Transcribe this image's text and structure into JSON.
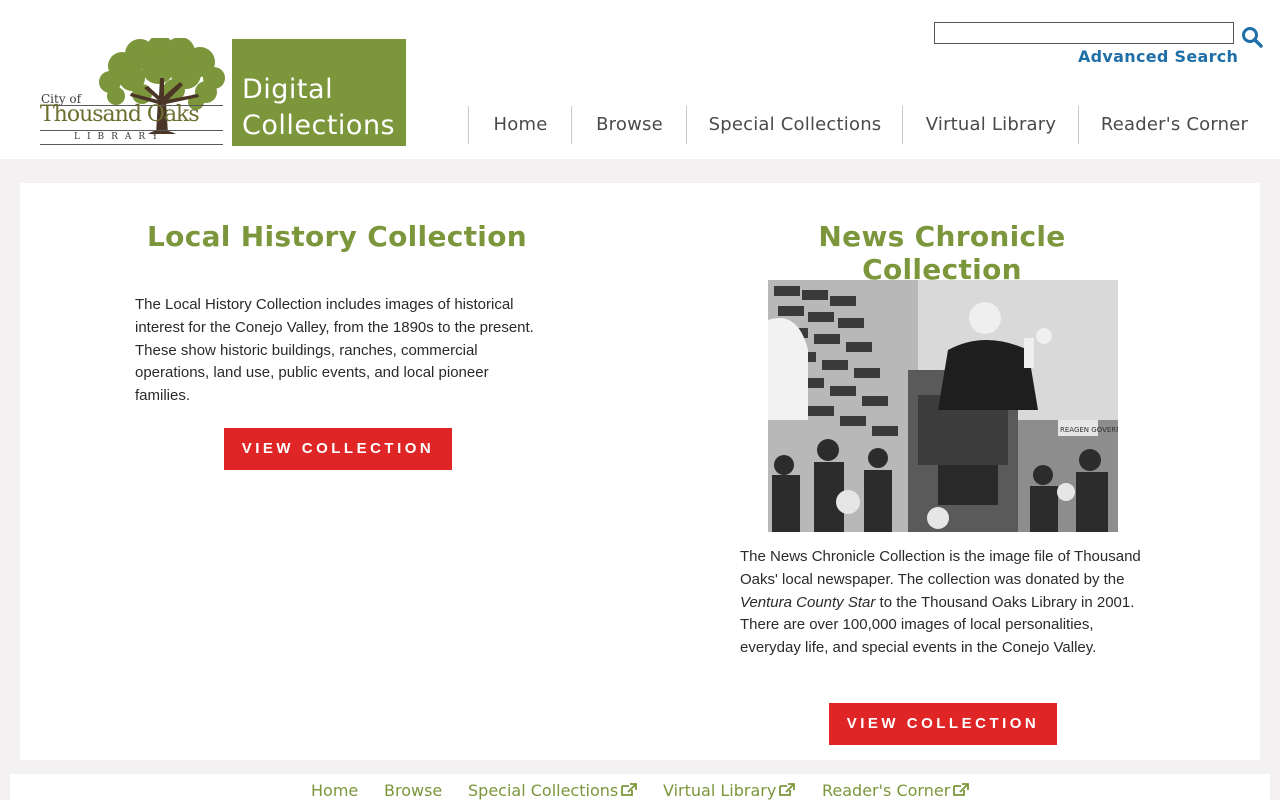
{
  "header": {
    "logo": {
      "city_of": "City of",
      "name": "Thousand Oaks",
      "library": "LIBRARY",
      "badge_line1": "Digital",
      "badge_line2": "Collections"
    },
    "search": {
      "value": "",
      "placeholder": "",
      "button_icon": "search-icon",
      "advanced_label": "Advanced Search"
    },
    "nav": [
      {
        "label": "Home"
      },
      {
        "label": "Browse"
      },
      {
        "label": "Special Collections"
      },
      {
        "label": "Virtual Library"
      },
      {
        "label": "Reader's Corner"
      }
    ]
  },
  "main": {
    "local_history": {
      "title": "Local History Collection",
      "description": "The Local History Collection includes images of historical interest for the Conejo Valley, from the 1890s to the present. These show historic buildings, ranches, commercial operations, land use, public events, and local pioneer families.",
      "button_label": "VIEW COLLECTION"
    },
    "news_chronicle": {
      "title": "News Chronicle Collection",
      "photo_sign": "REAGEN GOVERNOR",
      "description_before": "The News Chronicle Collection is the image file of Thousand Oaks' local newspaper. The collection was donated by the ",
      "description_italic": "Ventura County Star",
      "description_after": " to the Thousand Oaks Library in 2001. There are over 100,000 images of local personalities, everyday life, and special events in the Conejo Valley.",
      "button_label": "VIEW COLLECTION"
    }
  },
  "footer": {
    "links": [
      {
        "label": "Home",
        "external": false
      },
      {
        "label": "Browse",
        "external": false
      },
      {
        "label": "Special Collections",
        "external": true
      },
      {
        "label": "Virtual Library",
        "external": true
      },
      {
        "label": "Reader's Corner",
        "external": true
      }
    ],
    "external_icon": "external-link-icon"
  },
  "colors": {
    "brand_green": "#7c963b",
    "button_red": "#df2525",
    "link_blue": "#1f6fa8",
    "page_bg": "#f3f1f1"
  }
}
